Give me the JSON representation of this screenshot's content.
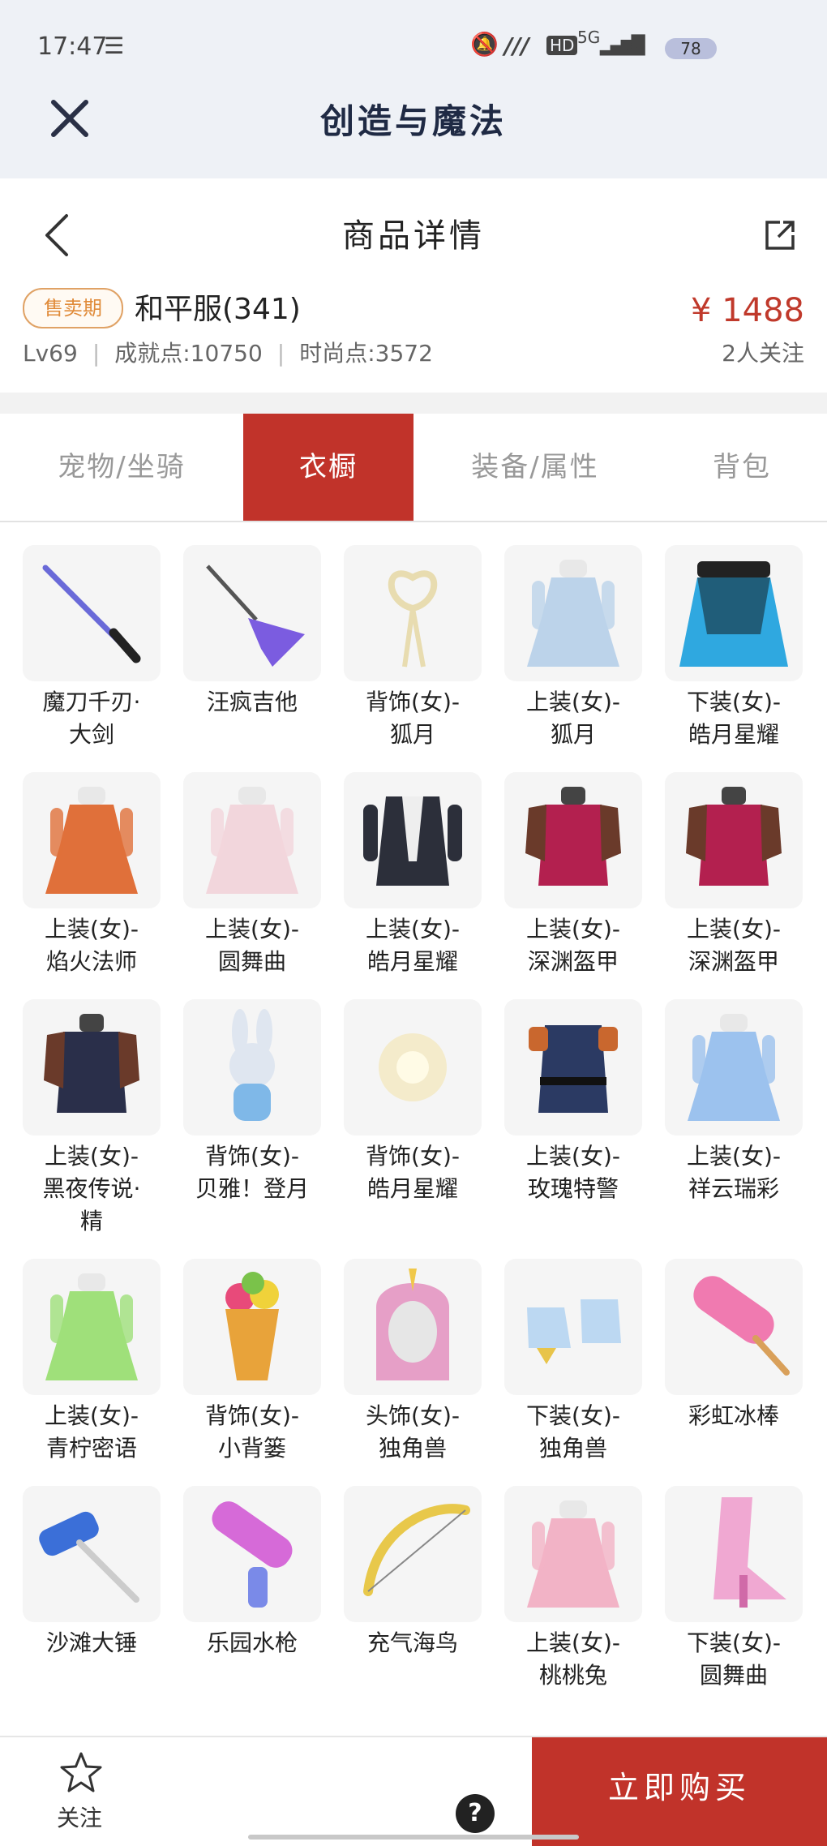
{
  "status_bar": {
    "time": "17:47",
    "network": "5G",
    "battery": "78"
  },
  "app_bar": {
    "title": "创造与魔法"
  },
  "page_header": {
    "title": "商品详情"
  },
  "product": {
    "badge": "售卖期",
    "name": "和平服(341)",
    "price": "¥ 1488",
    "level": "Lv69",
    "achievement": "成就点:10750",
    "fashion": "时尚点:3572",
    "followers": "2人关注"
  },
  "tabs": [
    {
      "label": "宠物/坐骑",
      "active": false
    },
    {
      "label": "衣橱",
      "active": true
    },
    {
      "label": "装备/属性",
      "active": false
    },
    {
      "label": "背包",
      "active": false
    }
  ],
  "items": [
    {
      "name": "魔刀千刃·\n大剑",
      "icon": "katana-icon",
      "color": "#6a6ad8"
    },
    {
      "name": "汪疯吉他",
      "icon": "guitar-icon",
      "color": "#7b5ce0"
    },
    {
      "name": "背饰(女)-\n狐月",
      "icon": "ribbon-icon",
      "color": "#e8dcb0"
    },
    {
      "name": "上装(女)-\n狐月",
      "icon": "dress-icon",
      "color": "#bcd3ea"
    },
    {
      "name": "下装(女)-\n皓月星耀",
      "icon": "skirt-icon",
      "color": "#2fa8e0"
    },
    {
      "name": "上装(女)-\n焰火法师",
      "icon": "dress-icon",
      "color": "#e0703a"
    },
    {
      "name": "上装(女)-\n圆舞曲",
      "icon": "dress-icon",
      "color": "#f2d6dc"
    },
    {
      "name": "上装(女)-\n皓月星耀",
      "icon": "jacket-icon",
      "color": "#2c2f3a"
    },
    {
      "name": "上装(女)-\n深渊盔甲",
      "icon": "armor-icon",
      "color": "#b3204f"
    },
    {
      "name": "上装(女)-\n深渊盔甲",
      "icon": "armor-icon",
      "color": "#b3204f"
    },
    {
      "name": "上装(女)-\n黑夜传说·\n精",
      "icon": "armor-icon",
      "color": "#2a2f4a"
    },
    {
      "name": "背饰(女)-\n贝雅！登月",
      "icon": "bunny-icon",
      "color": "#dfe6f0"
    },
    {
      "name": "背饰(女)-\n皓月星耀",
      "icon": "glow-orb-icon",
      "color": "#f4e09a"
    },
    {
      "name": "上装(女)-\n玫瑰特警",
      "icon": "uniform-icon",
      "color": "#2b3a63"
    },
    {
      "name": "上装(女)-\n祥云瑞彩",
      "icon": "dress-icon",
      "color": "#9cc2ee"
    },
    {
      "name": "上装(女)-\n青柠密语",
      "icon": "dress-icon",
      "color": "#9fe07a"
    },
    {
      "name": "背饰(女)-\n小背篓",
      "icon": "flower-basket-icon",
      "color": "#e8a33a"
    },
    {
      "name": "头饰(女)-\n独角兽",
      "icon": "unicorn-hood-icon",
      "color": "#e07ab3"
    },
    {
      "name": "下装(女)-\n独角兽",
      "icon": "boots-icon",
      "color": "#bcd8f2"
    },
    {
      "name": "彩虹冰棒",
      "icon": "popsicle-icon",
      "color": "#f07ab0"
    },
    {
      "name": "沙滩大锤",
      "icon": "hammer-icon",
      "color": "#3b6fd8"
    },
    {
      "name": "乐园水枪",
      "icon": "water-gun-icon",
      "color": "#d66ad8"
    },
    {
      "name": "充气海鸟",
      "icon": "bow-icon",
      "color": "#e8c84a"
    },
    {
      "name": "上装(女)-\n桃桃兔",
      "icon": "dress-icon",
      "color": "#f2b3c6"
    },
    {
      "name": "下装(女)-\n圆舞曲",
      "icon": "heels-icon",
      "color": "#f0a8d2"
    }
  ],
  "bottom_bar": {
    "favorite_label": "关注",
    "help": "?",
    "buy_label": "立即购买"
  }
}
